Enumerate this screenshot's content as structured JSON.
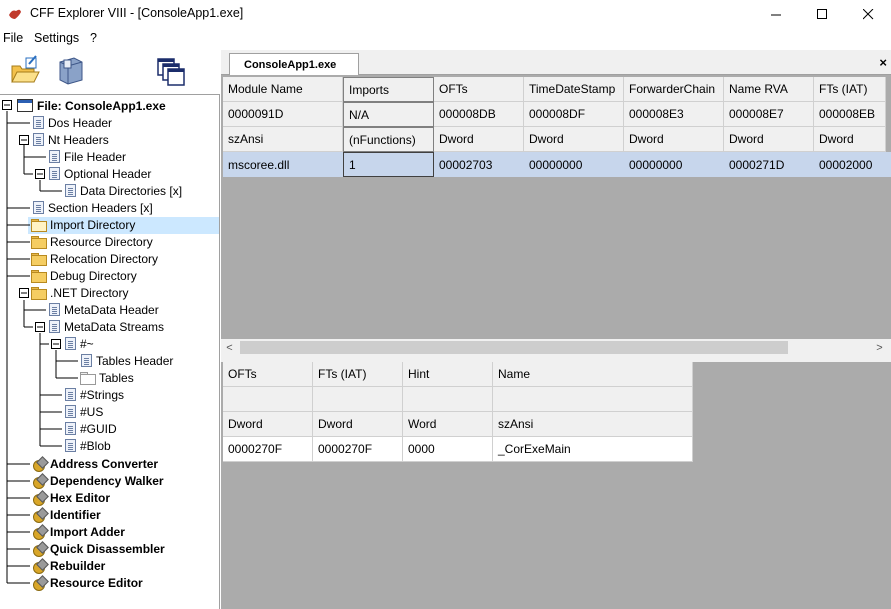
{
  "window": {
    "title": "CFF Explorer VIII - [ConsoleApp1.exe]"
  },
  "menu": {
    "items": [
      "File",
      "Settings",
      "?"
    ]
  },
  "toolbar": {
    "buttons": [
      "open-icon",
      "save-icon",
      "windows-icon"
    ]
  },
  "tree": {
    "root": "File: ConsoleApp1.exe",
    "nodes": [
      "Dos Header",
      "Nt Headers",
      "File Header",
      "Optional Header",
      "Data Directories [x]",
      "Section Headers [x]",
      "Import Directory",
      "Resource Directory",
      "Relocation Directory",
      "Debug Directory",
      ".NET Directory",
      "MetaData Header",
      "MetaData Streams",
      "#~",
      "Tables Header",
      "Tables",
      "#Strings",
      "#US",
      "#GUID",
      "#Blob"
    ],
    "tools": [
      "Address Converter",
      "Dependency Walker",
      "Hex Editor",
      "Identifier",
      "Import Adder",
      "Quick Disassembler",
      "Rebuilder",
      "Resource Editor"
    ]
  },
  "tab": {
    "label": "ConsoleApp1.exe",
    "close": "×"
  },
  "top_table": {
    "columns": [
      "Module Name",
      "Imports",
      "OFTs",
      "TimeDateStamp",
      "ForwarderChain",
      "Name RVA",
      "FTs (IAT)"
    ],
    "offsets": [
      "0000091D",
      "N/A",
      "000008DB",
      "000008DF",
      "000008E3",
      "000008E7",
      "000008EB"
    ],
    "types": [
      "szAnsi",
      "(nFunctions)",
      "Dword",
      "Dword",
      "Dword",
      "Dword",
      "Dword"
    ],
    "rows": [
      [
        "mscoree.dll",
        "1",
        "00002703",
        "00000000",
        "00000000",
        "0000271D",
        "00002000"
      ]
    ]
  },
  "scrollbar": {
    "left": "<",
    "right": ">"
  },
  "bottom_table": {
    "columns": [
      "OFTs",
      "FTs (IAT)",
      "Hint",
      "Name"
    ],
    "offsets": [
      "",
      "",
      "",
      ""
    ],
    "types": [
      "Dword",
      "Dword",
      "Word",
      "szAnsi"
    ],
    "rows": [
      [
        "0000270F",
        "0000270F",
        "0000",
        "_CorExeMain"
      ]
    ]
  }
}
